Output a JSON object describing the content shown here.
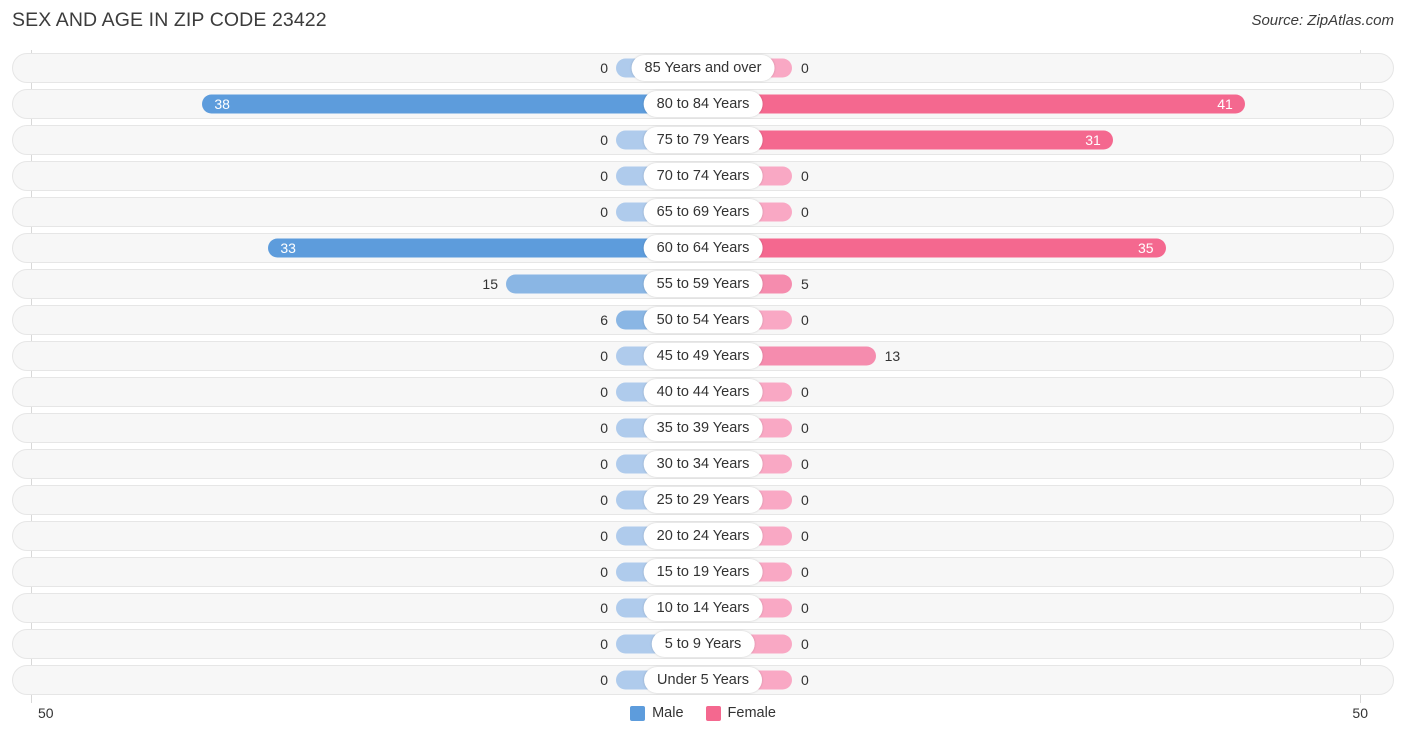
{
  "header": {
    "title": "SEX AND AGE IN ZIP CODE 23422",
    "source": "Source: ZipAtlas.com"
  },
  "legend": {
    "male_label": "Male",
    "female_label": "Female",
    "male_color": "#5d9cdc",
    "female_color": "#f4688f"
  },
  "axis": {
    "left_tick": "50",
    "right_tick": "50",
    "max": 50
  },
  "chart_data": {
    "type": "bar",
    "subtype": "population-pyramid",
    "title": "SEX AND AGE IN ZIP CODE 23422",
    "xlabel": "",
    "ylabel": "",
    "xlim": [
      50,
      50
    ],
    "grid": false,
    "legend_position": "bottom-center",
    "categories": [
      "85 Years and over",
      "80 to 84 Years",
      "75 to 79 Years",
      "70 to 74 Years",
      "65 to 69 Years",
      "60 to 64 Years",
      "55 to 59 Years",
      "50 to 54 Years",
      "45 to 49 Years",
      "40 to 44 Years",
      "35 to 39 Years",
      "30 to 34 Years",
      "25 to 29 Years",
      "20 to 24 Years",
      "15 to 19 Years",
      "10 to 14 Years",
      "5 to 9 Years",
      "Under 5 Years"
    ],
    "series": [
      {
        "name": "Male",
        "color": "#5d9cdc",
        "values": [
          0,
          38,
          0,
          0,
          0,
          33,
          15,
          6,
          0,
          0,
          0,
          0,
          0,
          0,
          0,
          0,
          0,
          0
        ]
      },
      {
        "name": "Female",
        "color": "#f4688f",
        "values": [
          0,
          41,
          31,
          0,
          0,
          35,
          5,
          0,
          13,
          0,
          0,
          0,
          0,
          0,
          0,
          0,
          0,
          0
        ]
      }
    ]
  },
  "rows": [
    {
      "label": "85 Years and over",
      "male": "0",
      "female": "0"
    },
    {
      "label": "80 to 84 Years",
      "male": "38",
      "female": "41"
    },
    {
      "label": "75 to 79 Years",
      "male": "0",
      "female": "31"
    },
    {
      "label": "70 to 74 Years",
      "male": "0",
      "female": "0"
    },
    {
      "label": "65 to 69 Years",
      "male": "0",
      "female": "0"
    },
    {
      "label": "60 to 64 Years",
      "male": "33",
      "female": "35"
    },
    {
      "label": "55 to 59 Years",
      "male": "15",
      "female": "5"
    },
    {
      "label": "50 to 54 Years",
      "male": "6",
      "female": "0"
    },
    {
      "label": "45 to 49 Years",
      "male": "0",
      "female": "13"
    },
    {
      "label": "40 to 44 Years",
      "male": "0",
      "female": "0"
    },
    {
      "label": "35 to 39 Years",
      "male": "0",
      "female": "0"
    },
    {
      "label": "30 to 34 Years",
      "male": "0",
      "female": "0"
    },
    {
      "label": "25 to 29 Years",
      "male": "0",
      "female": "0"
    },
    {
      "label": "20 to 24 Years",
      "male": "0",
      "female": "0"
    },
    {
      "label": "15 to 19 Years",
      "male": "0",
      "female": "0"
    },
    {
      "label": "10 to 14 Years",
      "male": "0",
      "female": "0"
    },
    {
      "label": "5 to 9 Years",
      "male": "0",
      "female": "0"
    },
    {
      "label": "Under 5 Years",
      "male": "0",
      "female": "0"
    }
  ]
}
